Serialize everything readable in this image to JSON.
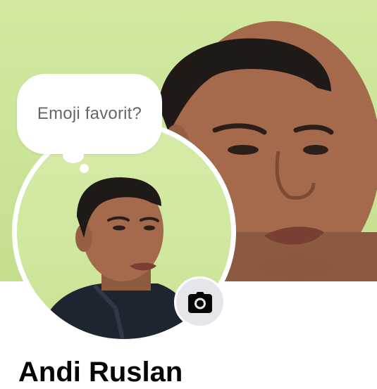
{
  "profile": {
    "name": "Andi Ruslan",
    "thought_bubble": "Emoji favorit?",
    "camera_icon": "camera-icon"
  },
  "colors": {
    "cover_background": "#cbe59a",
    "camera_button_bg": "#e4e6eb",
    "bubble_text": "#65676b",
    "name_text": "#050505"
  }
}
